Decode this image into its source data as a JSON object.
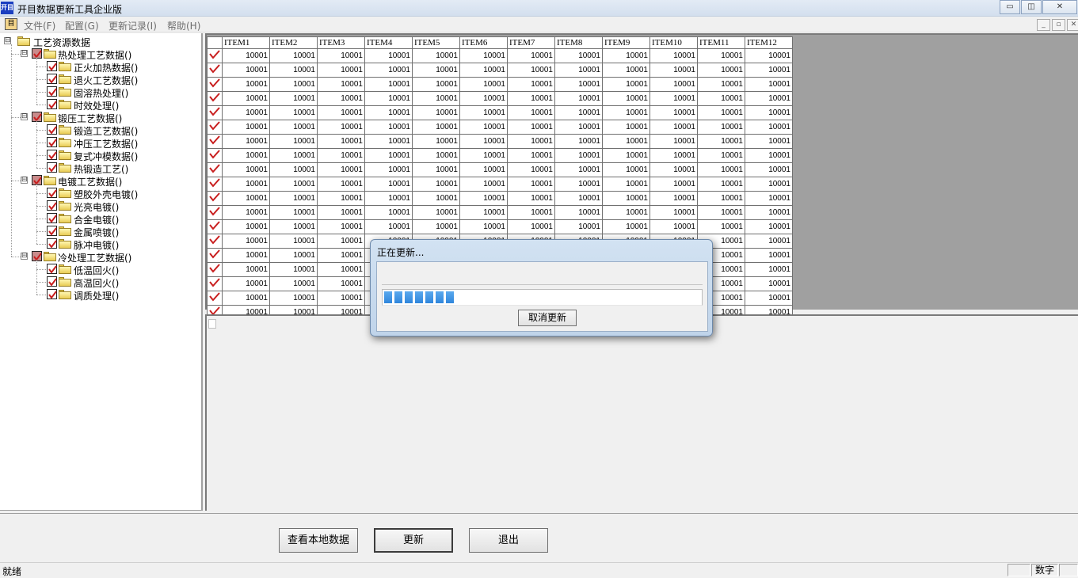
{
  "window": {
    "title": "开目数据更新工具企业版",
    "app_icon_glyph": "开目",
    "min_glyph": "▭",
    "restore_glyph": "◫",
    "close_glyph": "✕"
  },
  "menu": {
    "icon_glyph": "目",
    "items": [
      "文件(F)",
      "配置(G)",
      "更新记录(I)",
      "帮助(H)"
    ],
    "mdi_min": "_",
    "mdi_restore": "▫",
    "mdi_close": "✕"
  },
  "tree": {
    "root": "工艺资源数据",
    "groups": [
      {
        "label": "热处理工艺数据()",
        "children": [
          "正火加热数据()",
          "退火工艺数据()",
          "固溶热处理()",
          "时效处理()"
        ]
      },
      {
        "label": "锻压工艺数据()",
        "children": [
          "锻造工艺数据()",
          "冲压工艺数据()",
          "复式冲模数据()",
          "热锻造工艺()"
        ]
      },
      {
        "label": "电镀工艺数据()",
        "children": [
          "塑胶外壳电镀()",
          "光亮电镀()",
          "合金电镀()",
          "金属喷镀()",
          "脉冲电镀()"
        ]
      },
      {
        "label": "冷处理工艺数据()",
        "children": [
          "低温回火()",
          "高温回火()",
          "调质处理()"
        ]
      }
    ],
    "expand_glyph": "⊟"
  },
  "grid": {
    "columns": [
      "ITEM1",
      "ITEM2",
      "ITEM3",
      "ITEM4",
      "ITEM5",
      "ITEM6",
      "ITEM7",
      "ITEM8",
      "ITEM9",
      "ITEM10",
      "ITEM11",
      "ITEM12"
    ],
    "row_count": 20,
    "cell_value": "10001"
  },
  "dialog": {
    "title": "正在更新...",
    "cancel_label": "取消更新",
    "progress_blocks": 7
  },
  "buttons": {
    "view_local": "查看本地数据",
    "update": "更新",
    "exit": "退出"
  },
  "status": {
    "text": "就绪",
    "num_indicator": "数字"
  },
  "colors": {
    "checkmark": "#c81e1e",
    "progress": "#3b8fe0",
    "grid_bg": "#a0a0a0"
  }
}
